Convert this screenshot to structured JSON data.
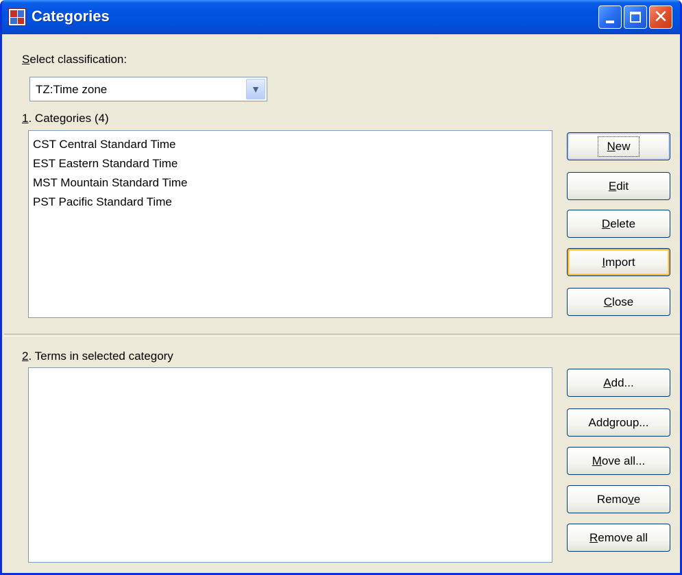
{
  "window": {
    "title": "Categories",
    "icon": "categories-grid-icon"
  },
  "classification": {
    "label_prefix": "",
    "label_accel": "S",
    "label_rest": "elect classification:",
    "selected": "TZ:Time zone"
  },
  "categories": {
    "accel": "1",
    "label_rest": ". Categories (4)",
    "items": [
      "CST Central Standard Time",
      "EST Eastern Standard Time",
      "MST Mountain Standard Time",
      "PST Pacific Standard Time"
    ],
    "buttons": [
      {
        "pre": "",
        "accel": "N",
        "post": "ew"
      },
      {
        "pre": "",
        "accel": "E",
        "post": "dit"
      },
      {
        "pre": "",
        "accel": "D",
        "post": "elete"
      },
      {
        "pre": "",
        "accel": "I",
        "post": "mport"
      },
      {
        "pre": "",
        "accel": "C",
        "post": "lose"
      }
    ]
  },
  "terms": {
    "accel": "2",
    "label_rest": ". Terms in selected category",
    "items": [],
    "buttons": [
      {
        "pre": "",
        "accel": "A",
        "post": "dd..."
      },
      {
        "pre": "Add ",
        "accel": "g",
        "post": "roup..."
      },
      {
        "pre": "",
        "accel": "M",
        "post": "ove all..."
      },
      {
        "pre": "Remo",
        "accel": "v",
        "post": "e"
      },
      {
        "pre": "",
        "accel": "R",
        "post": "emove all"
      }
    ]
  },
  "colors": {
    "titlebar": "#0054e3",
    "window_bg": "#ece9d8",
    "close_button": "#e0502d",
    "hot_button_outline": "#f8b636"
  }
}
